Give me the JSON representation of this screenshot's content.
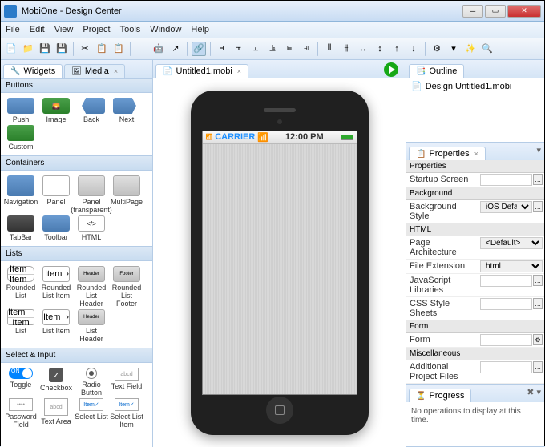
{
  "title": "MobiOne - Design Center",
  "menu": [
    "File",
    "Edit",
    "View",
    "Project",
    "Tools",
    "Window",
    "Help"
  ],
  "leftTabs": {
    "widgets": "Widgets",
    "media": "Media"
  },
  "docTab": "Untitled1.mobi",
  "outline": {
    "title": "Outline",
    "item": "Design Untitled1.mobi"
  },
  "phone": {
    "carrier": "CARRIER",
    "time": "12:00 PM"
  },
  "categories": {
    "buttons": "Buttons",
    "containers": "Containers",
    "lists": "Lists",
    "selectInput": "Select & Input"
  },
  "widgets": {
    "push": "Push",
    "image": "Image",
    "back": "Back",
    "next": "Next",
    "custom": "Custom",
    "navigation": "Navigation",
    "panel": "Panel",
    "panelT": "Panel\n(transparent)",
    "multipage": "MultiPage",
    "tabbar": "TabBar",
    "toolbar": "Toolbar",
    "html": "HTML",
    "roundedList": "Rounded List",
    "roundedListItem": "Rounded List Item",
    "roundedListHeader": "Rounded List Header",
    "roundedListFooter": "Rounded List Footer",
    "list": "List",
    "listItem": "List Item",
    "listHeader": "List Header",
    "toggle": "Toggle",
    "checkbox": "Checkbox",
    "radioButton": "Radio Button",
    "textField": "Text Field",
    "passwordField": "Password Field",
    "textArea": "Text Area",
    "selectList": "Select List",
    "selectListItem": "Select List Item",
    "header": "Header",
    "footer": "Footer",
    "item": "Item",
    "itemChk": "Item✓",
    "abc": "abcd"
  },
  "properties": {
    "title": "Properties",
    "sections": {
      "properties": "Properties",
      "background": "Background",
      "html": "HTML",
      "form": "Form",
      "misc": "Miscellaneous"
    },
    "rows": {
      "startup": "Startup Screen",
      "bgStyle": "Background Style",
      "bgStyleVal": "iOS Default (strip...",
      "pageArch": "Page Architecture",
      "pageArchVal": "<Default>",
      "fileExt": "File Extension",
      "fileExtVal": "html",
      "jsLibs": "JavaScript Libraries",
      "css": "CSS Style Sheets",
      "form": "Form",
      "addFiles": "Additional Project Files"
    }
  },
  "progress": {
    "title": "Progress",
    "msg": "No operations to display at this time."
  }
}
